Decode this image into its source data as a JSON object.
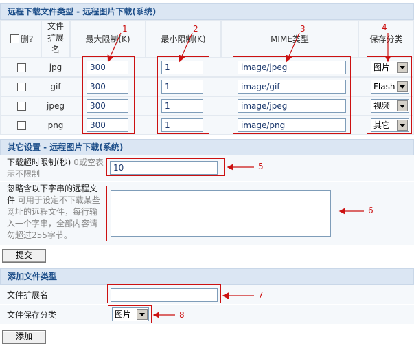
{
  "section1": {
    "title": "远程下载文件类型  -  远程图片下载(系统)",
    "headers": {
      "delete": "删?",
      "ext": "文件扩展名",
      "max": "最大限制(K)",
      "min": "最小限制(K)",
      "mime": "MIME类型",
      "category": "保存分类"
    },
    "rows": [
      {
        "ext": "jpg",
        "max": "300",
        "min": "1",
        "mime": "image/jpeg",
        "category": "图片"
      },
      {
        "ext": "gif",
        "max": "300",
        "min": "1",
        "mime": "image/gif",
        "category": "Flash"
      },
      {
        "ext": "jpeg",
        "max": "300",
        "min": "1",
        "mime": "image/jpeg",
        "category": "视频"
      },
      {
        "ext": "png",
        "max": "300",
        "min": "1",
        "mime": "image/png",
        "category": "其它"
      }
    ]
  },
  "section2": {
    "title": "其它设置  -  远程图片下载(系统)",
    "timeout_label": "下载超时限制(秒)",
    "timeout_hint": "0或空表示不限制",
    "timeout_value": "10",
    "ignore_label": "忽略含以下字串的远程文件",
    "ignore_hint": "可用于设定不下载某些网址的远程文件，每行输入一个字串，全部内容请勿超过255字节。",
    "ignore_value": "",
    "submit": "提交"
  },
  "section3": {
    "title": "添加文件类型",
    "ext_label": "文件扩展名",
    "ext_value": "",
    "cat_label": "文件保存分类",
    "cat_value": "图片",
    "add": "添加"
  },
  "callouts": [
    "1",
    "2",
    "3",
    "4",
    "5",
    "6",
    "7",
    "8"
  ],
  "colors": {
    "annotation": "#cc1111",
    "header_bg": "#dbe6f3",
    "header_text": "#1e4f8a"
  }
}
